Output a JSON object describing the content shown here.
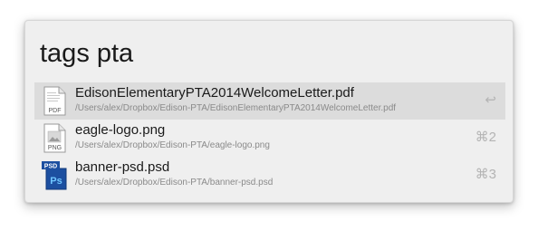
{
  "search": {
    "query": "tags pta"
  },
  "results": [
    {
      "title": "EdisonElementaryPTA2014WelcomeLetter.pdf",
      "path": "/Users/alex/Dropbox/Edison-PTA/EdisonElementaryPTA2014WelcomeLetter.pdf",
      "shortcut": "↩",
      "icon": "pdf-file-icon",
      "icon_label": "PDF"
    },
    {
      "title": "eagle-logo.png",
      "path": "/Users/alex/Dropbox/Edison-PTA/eagle-logo.png",
      "shortcut": "⌘2",
      "icon": "png-file-icon",
      "icon_label": "PNG"
    },
    {
      "title": "banner-psd.psd",
      "path": "/Users/alex/Dropbox/Edison-PTA/banner-psd.psd",
      "shortcut": "⌘3",
      "icon": "photoshop-file-icon",
      "icon_label": "PSD",
      "icon_label_2": "Ps"
    }
  ],
  "colors": {
    "selected_row": "#dcdcdc",
    "window_bg": "#efefef",
    "photoshop_blue": "#1c4fa0"
  }
}
